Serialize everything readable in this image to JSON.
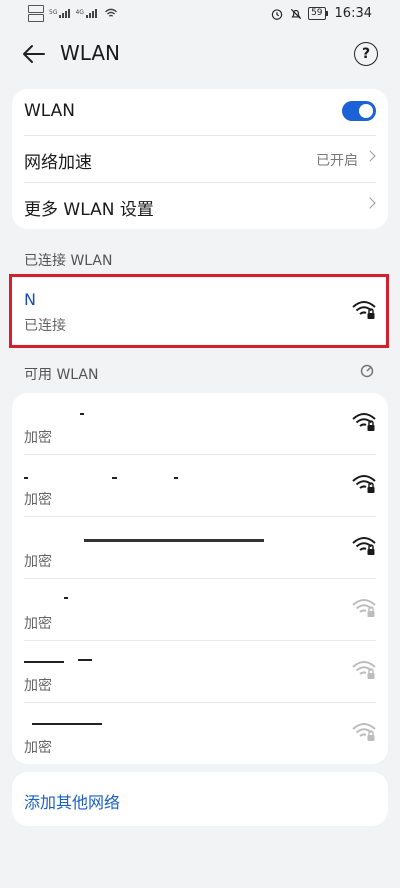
{
  "status_bar": {
    "signal_labels": [
      "5G",
      "4G"
    ],
    "battery": "59",
    "time": "16:34"
  },
  "header": {
    "title": "WLAN",
    "help": "?"
  },
  "settings": {
    "wlan_label": "WLAN",
    "wlan_enabled": true,
    "acceleration_label": "网络加速",
    "acceleration_value": "已开启",
    "more_label": "更多 WLAN 设置"
  },
  "connected_section": {
    "title": "已连接 WLAN",
    "network": {
      "name": "N",
      "status": "已连接",
      "signal": "strong",
      "secured": true
    }
  },
  "available_section": {
    "title": "可用 WLAN",
    "networks": [
      {
        "name": "",
        "status": "加密",
        "signal": "strong"
      },
      {
        "name": "",
        "status": "加密",
        "signal": "strong"
      },
      {
        "name": "",
        "status": "加密",
        "signal": "strong"
      },
      {
        "name": "",
        "status": "加密",
        "signal": "weak"
      },
      {
        "name": "",
        "status": "加密",
        "signal": "weak"
      },
      {
        "name": "",
        "status": "加密",
        "signal": "weak"
      }
    ]
  },
  "add_network": {
    "label": "添加其他网络"
  },
  "colors": {
    "accent": "#1a62d6",
    "highlight_border": "#d2202d",
    "background": "#f1f3f5"
  }
}
